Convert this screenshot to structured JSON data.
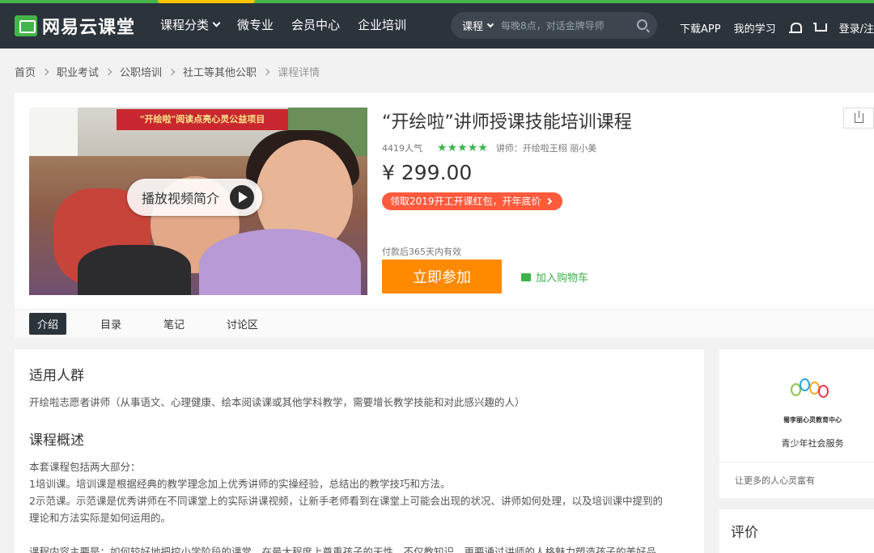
{
  "header": {
    "logo_text": "网易云课堂",
    "nav": [
      "课程分类",
      "微专业",
      "会员中心",
      "企业培训"
    ],
    "search": {
      "category": "课程",
      "placeholder": "每晚8点，对话金牌导师"
    },
    "right": {
      "download": "下载APP",
      "my_learning": "我的学习",
      "login": "登录/注"
    }
  },
  "breadcrumb": [
    "首页",
    "职业考试",
    "公职培训",
    "社工等其他公职",
    "课程详情"
  ],
  "course": {
    "video": {
      "banner_text": "\"开绘啦\"阅读点亮心灵公益项目",
      "play_label": "播放视频简介"
    },
    "title": "“开绘啦”讲师授课技能培训课程",
    "popularity": "4419人气",
    "rating": 5,
    "teacher": "讲师：开绘啦王栩 丽小美",
    "price": "¥ 299.00",
    "coupon": "领取2019开工开课红包，开年底价",
    "validity": "付款后365天内有效",
    "join_label": "立即参加",
    "cart_label": "加入购物车"
  },
  "tabs": [
    "介绍",
    "目录",
    "笔记",
    "讨论区"
  ],
  "content": {
    "audience_title": "适用人群",
    "audience_text": "开绘啦志愿者讲师（从事语文、心理健康、绘本阅读课或其他学科教学，需要增长教学技能和对此感兴趣的人）",
    "overview_title": "课程概述",
    "overview_lines": [
      "本套课程包括两大部分：",
      "1培训课。培训课是根据经典的教学理念加上优秀讲师的实操经验，总结出的教学技巧和方法。",
      "2示范课。示范课是优秀讲师在不同课堂上的实际讲课视频，让新手老师看到在课堂上可能会出现的状况、讲师如何处理，以及培训课中提到的",
      "理论和方法实际是如何运用的。",
      "",
      "课程内容主要是：如何较好地把控小学阶段的课堂，在最大程度上尊重孩子的天性，不仅教知识，更要通过讲师的人格魅力塑造孩子的美好品"
    ]
  },
  "sidebar": {
    "org_name": "蜀李丽心灵教育中心",
    "org_sub": "青少年社会服务",
    "slogan": "让更多的人心灵富有",
    "review_title": "评价"
  }
}
